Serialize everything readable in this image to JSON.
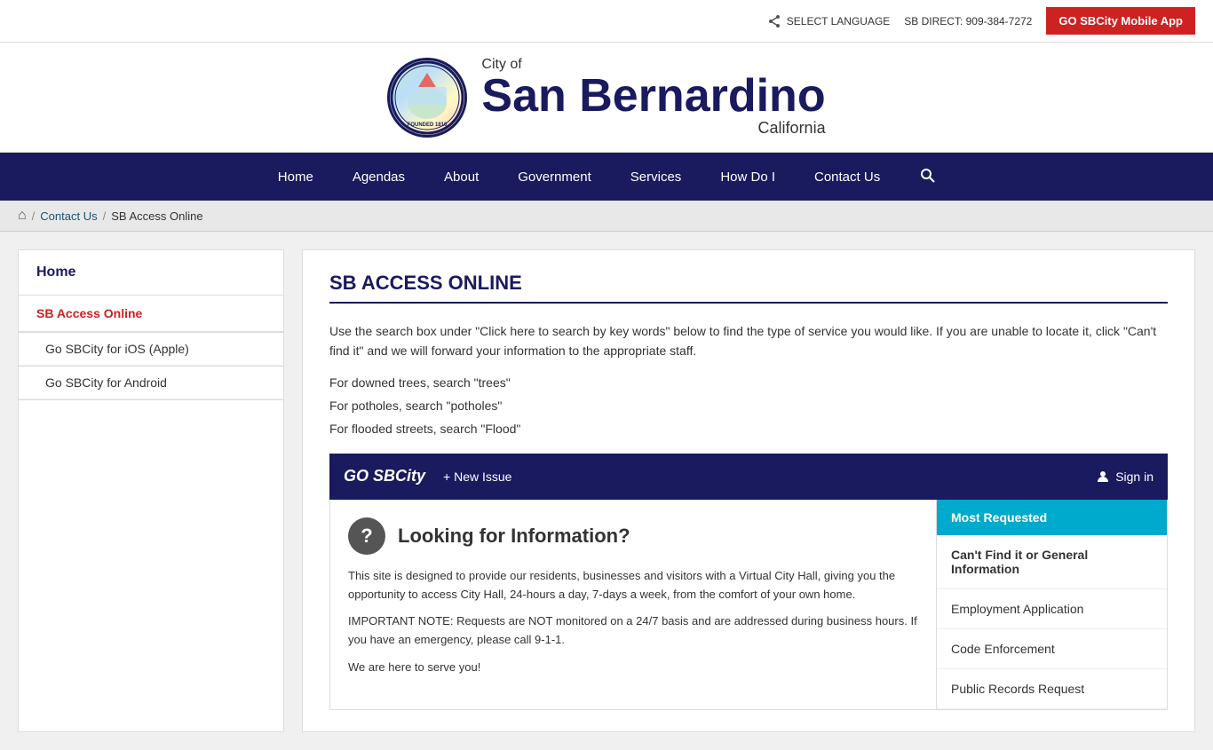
{
  "topbar": {
    "language_label": "SELECT LANGUAGE",
    "direct_label": "SB DIRECT: 909-384-7272",
    "app_button": "GO SBCity Mobile App"
  },
  "header": {
    "city_of": "City of",
    "city_name": "San Bernardino",
    "state": "California",
    "seal_text": "SAN BERNARDINO\nFOUNDED IN 1810"
  },
  "nav": {
    "items": [
      {
        "label": "Home",
        "id": "home"
      },
      {
        "label": "Agendas",
        "id": "agendas"
      },
      {
        "label": "About",
        "id": "about"
      },
      {
        "label": "Government",
        "id": "government"
      },
      {
        "label": "Services",
        "id": "services"
      },
      {
        "label": "How Do I",
        "id": "how-do-i"
      },
      {
        "label": "Contact Us",
        "id": "contact-us"
      }
    ]
  },
  "breadcrumb": {
    "home_title": "Home",
    "contact_us": "Contact Us",
    "current": "SB Access Online"
  },
  "sidebar": {
    "home_label": "Home",
    "active_item": "SB Access Online",
    "sub_items": [
      {
        "label": "Go SBCity for iOS (Apple)"
      },
      {
        "label": "Go SBCity for Android"
      }
    ]
  },
  "content": {
    "page_title": "SB ACCESS ONLINE",
    "description": "Use the search box under \"Click here to search by key words\" below to find the type of service you would like. If you are unable to locate it, click \"Can't find it\" and we will forward your information to the appropriate staff.",
    "tips": [
      "For downed trees, search \"trees\"",
      "For potholes, search \"potholes\"",
      "For flooded streets, search \"Flood\""
    ]
  },
  "go_sbcity": {
    "title": "GO SBCity",
    "new_issue": "+ New Issue",
    "sign_in": "Sign in",
    "widget_title": "Looking for Information?",
    "widget_body_1": "This site is designed to provide our residents, businesses and visitors with a Virtual City Hall, giving you the opportunity to access City Hall, 24-hours a day, 7-days a week, from the comfort of your own home.",
    "widget_body_2": "IMPORTANT NOTE: Requests are NOT monitored on a 24/7 basis and are addressed during business hours. If you have an emergency, please call 9-1-1.",
    "widget_body_3": "We are here to serve you!",
    "most_requested": "Most Requested",
    "sidebar_items": [
      {
        "label": "Can't Find it or General Information",
        "bold": true
      },
      {
        "label": "Employment Application",
        "bold": false
      },
      {
        "label": "Code Enforcement",
        "bold": false
      },
      {
        "label": "Public Records Request",
        "bold": false
      }
    ]
  }
}
